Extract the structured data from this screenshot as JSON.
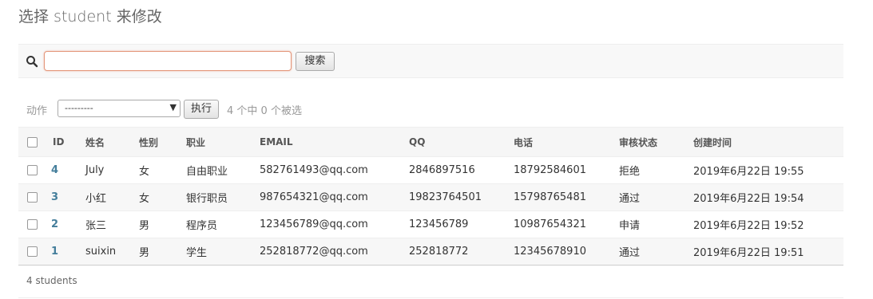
{
  "page": {
    "title": "选择 student 来修改"
  },
  "search": {
    "value": "",
    "placeholder": "",
    "button_label": "搜索",
    "icon": "search-icon"
  },
  "actions": {
    "label": "动作",
    "select_value": "---------",
    "go_label": "执行",
    "counter": "4 个中 0 个被选"
  },
  "table": {
    "headers": [
      "ID",
      "姓名",
      "性别",
      "职业",
      "EMAIL",
      "QQ",
      "电话",
      "审核状态",
      "创建时间"
    ],
    "rows": [
      {
        "id": "4",
        "name": "July",
        "gender": "女",
        "job": "自由职业",
        "email": "582761493@qq.com",
        "qq": "2846897516",
        "phone": "18792584601",
        "status": "拒绝",
        "created": "2019年6月22日 19:55"
      },
      {
        "id": "3",
        "name": "小红",
        "gender": "女",
        "job": "银行职员",
        "email": "987654321@qq.com",
        "qq": "19823764501",
        "phone": "15798765481",
        "status": "通过",
        "created": "2019年6月22日 19:54"
      },
      {
        "id": "2",
        "name": "张三",
        "gender": "男",
        "job": "程序员",
        "email": "123456789@qq.com",
        "qq": "123456789",
        "phone": "10987654321",
        "status": "申请",
        "created": "2019年6月22日 19:52"
      },
      {
        "id": "1",
        "name": "suixin",
        "gender": "男",
        "job": "学生",
        "email": "252818772@qq.com",
        "qq": "252818772",
        "phone": "12345678910",
        "status": "通过",
        "created": "2019年6月22日 19:51"
      }
    ]
  },
  "footer": {
    "count": "4 students"
  },
  "colors": {
    "link": "#447e9b",
    "input_focus_border": "#e4967a"
  }
}
